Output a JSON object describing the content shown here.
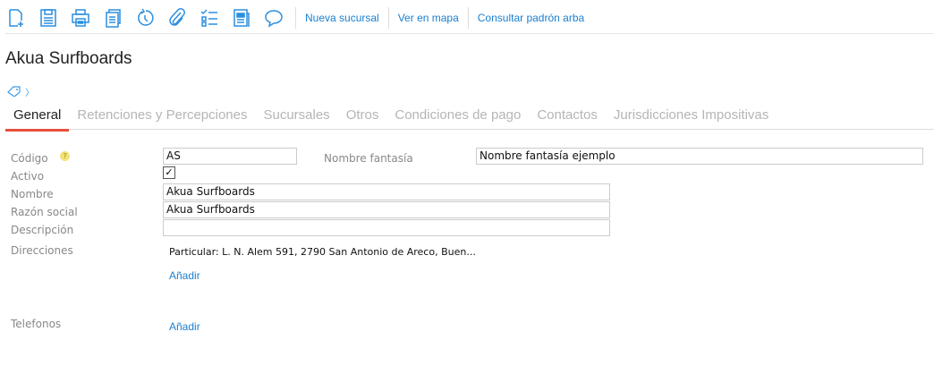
{
  "toolbar": {
    "icons": [
      "new-document-icon",
      "save-icon",
      "print-icon",
      "copy-icon",
      "history-icon",
      "attach-icon",
      "checklist-icon",
      "report-icon",
      "comment-icon"
    ],
    "links": [
      "Nueva sucursal",
      "Ver en mapa",
      "Consultar padrón arba"
    ]
  },
  "title": "Akua Surfboards",
  "breadcrumb": {
    "icon": "tag-icon",
    "sep": "〉"
  },
  "tabs": [
    "General",
    "Retenciones y Percepciones",
    "Sucursales",
    "Otros",
    "Condiciones de pago",
    "Contactos",
    "Jurisdicciones Impositivas"
  ],
  "form": {
    "codigo_label": "Código",
    "codigo": "AS",
    "help": "?",
    "nombre_fantasia_label": "Nombre fantasía",
    "nombre_fantasia": "Nombre fantasía ejemplo",
    "activo_label": "Activo",
    "activo_check": "✓",
    "nombre_label": "Nombre",
    "nombre": "Akua Surfboards",
    "razon_label": "Razón social",
    "razon": "Akua Surfboards",
    "descripcion_label": "Descripción",
    "descripcion": "",
    "direcciones_label": "Direcciones",
    "direccion": "Particular: L. N. Alem 591, 2790 San Antonio de Areco, Buen...",
    "add_label": "Añadir",
    "telefonos_label": "Telefonos"
  }
}
